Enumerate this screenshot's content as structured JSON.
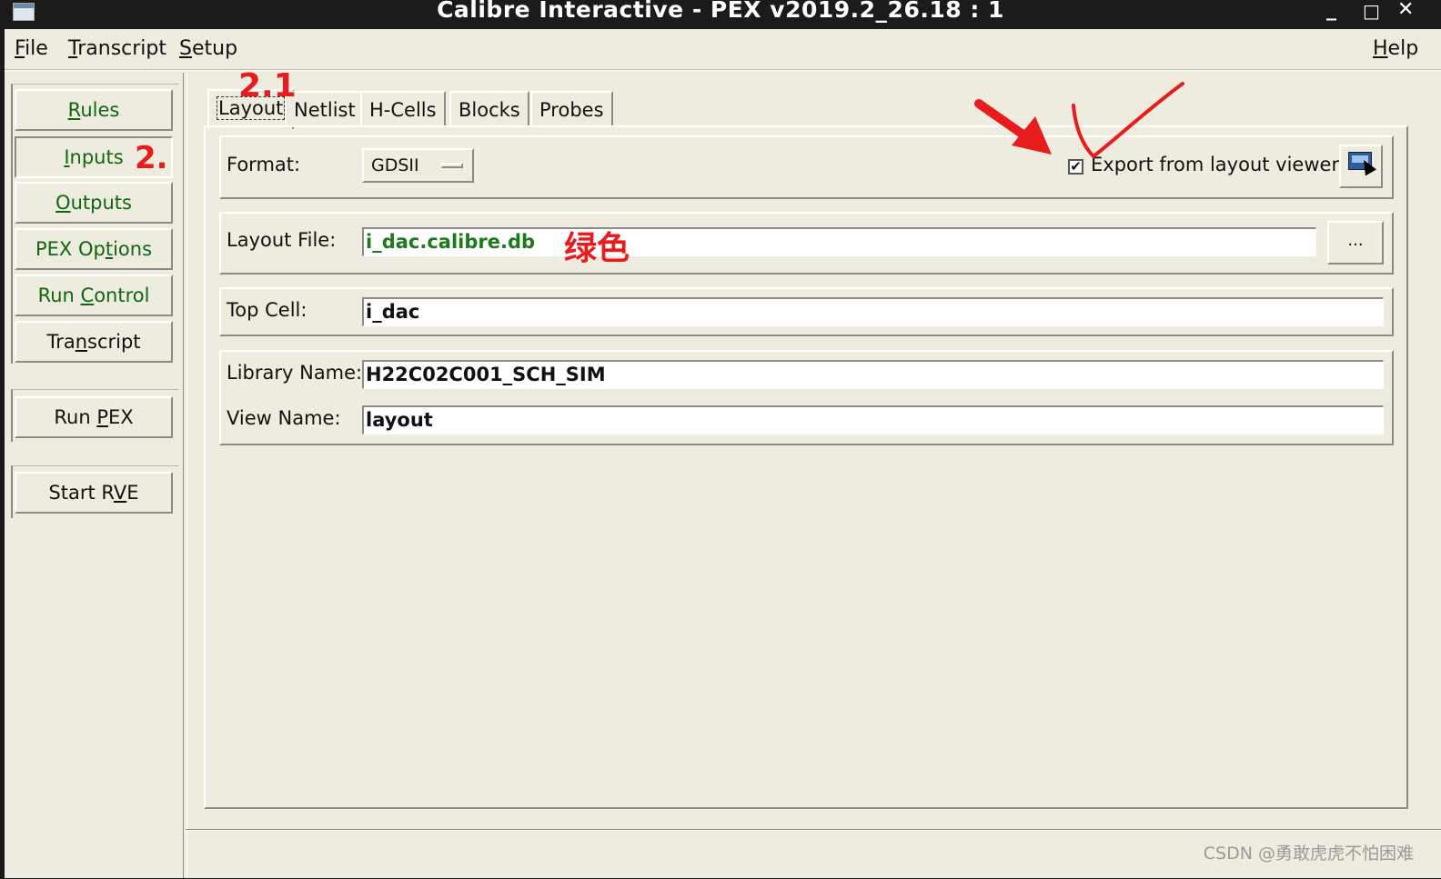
{
  "window": {
    "title": "Calibre Interactive - PEX v2019.2_26.18 : 1",
    "controls": {
      "minimize": "_",
      "maximize": "□",
      "close": "✕"
    }
  },
  "menubar": {
    "file": {
      "mnemonic": "F",
      "rest": "ile"
    },
    "transcript": {
      "mnemonic": "T",
      "rest": "ranscript"
    },
    "setup": {
      "mnemonic": "S",
      "rest": "etup"
    },
    "help": {
      "mnemonic": "H",
      "rest": "elp"
    }
  },
  "sidebar": {
    "rules": {
      "pre": "",
      "mnemonic": "R",
      "post": "ules"
    },
    "inputs": {
      "pre": "",
      "mnemonic": "I",
      "post": "nputs"
    },
    "outputs": {
      "pre": "",
      "mnemonic": "O",
      "post": "utputs"
    },
    "pex_options": {
      "pre": "PEX Op",
      "mnemonic": "t",
      "post": "ions"
    },
    "run_control": {
      "pre": "Run ",
      "mnemonic": "C",
      "post": "ontrol"
    },
    "transcript": {
      "pre": "Tra",
      "mnemonic": "n",
      "post": "script"
    },
    "run_pex": {
      "pre": "Run ",
      "mnemonic": "P",
      "post": "EX"
    },
    "start_rve": {
      "pre": "Start R",
      "mnemonic": "V",
      "post": "E"
    }
  },
  "tabs": {
    "layout": "Layout",
    "netlist": "Netlist",
    "hcells": "H-Cells",
    "blocks": "Blocks",
    "probes": "Probes"
  },
  "form": {
    "format_label": "Format:",
    "format_value": "GDSII",
    "export_label": "Export from layout viewer",
    "export_checked": true,
    "export_check_glyph": "✔",
    "layout_file_label": "Layout File:",
    "layout_file_value": "i_dac.calibre.db",
    "layout_file_color": "#1c7a1c",
    "browse_label": "...",
    "top_cell_label": "Top Cell:",
    "top_cell_value": "i_dac",
    "library_name_label": "Library Name:",
    "library_name_value": "H22C02C001_SCH_SIM",
    "view_name_label": "View Name:",
    "view_name_value": "layout"
  },
  "annotations": {
    "step_inputs": "2.",
    "step_layout": "2.1",
    "green_note": "绿色",
    "color": "#e81c1c"
  },
  "icons": {
    "viewer": "layout-viewer-icon",
    "window": "app-window-icon"
  },
  "watermark": "CSDN @勇敢虎虎不怕困难"
}
